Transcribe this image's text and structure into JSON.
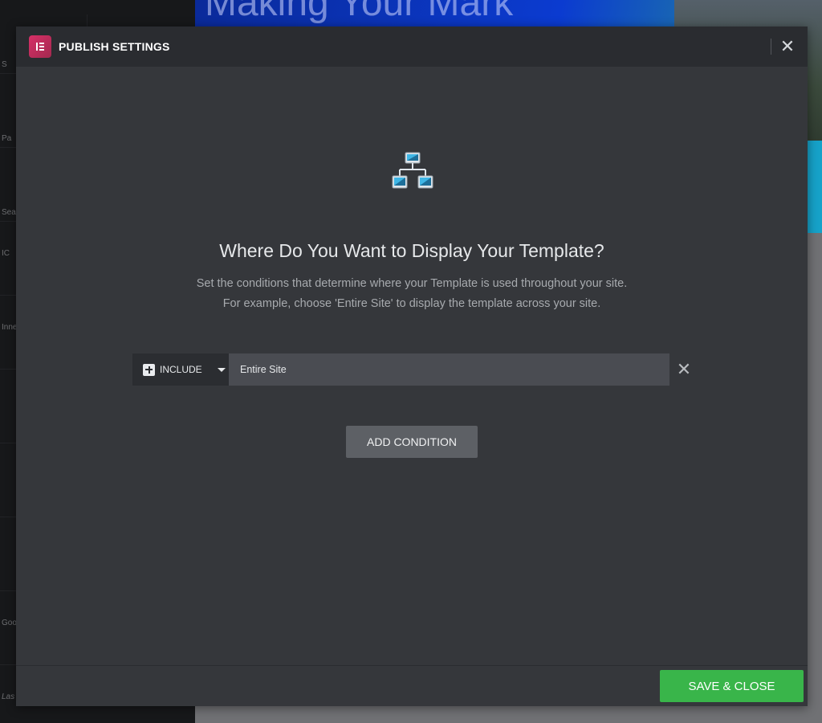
{
  "background": {
    "hero_title": "Making Your Mark",
    "sidebar_fragments": [
      "S",
      "Pa",
      "Sea",
      "IC",
      "Inne",
      "",
      "Goo",
      "Las"
    ]
  },
  "modal": {
    "title": "PUBLISH SETTINGS",
    "close_icon": "close-icon",
    "headline": "Where Do You Want to Display Your Template?",
    "description_line1": "Set the conditions that determine where your Template is used throughout your site.",
    "description_line2": "For example, choose 'Entire Site' to display the template across your site.",
    "conditions": [
      {
        "type": "INCLUDE",
        "scope": "Entire Site"
      }
    ],
    "add_condition_label": "ADD CONDITION",
    "save_close_label": "SAVE & CLOSE"
  },
  "colors": {
    "brand": "#d63067",
    "save": "#39b54a",
    "modal_bg": "#35373b",
    "header_bg": "#2a2c30"
  }
}
